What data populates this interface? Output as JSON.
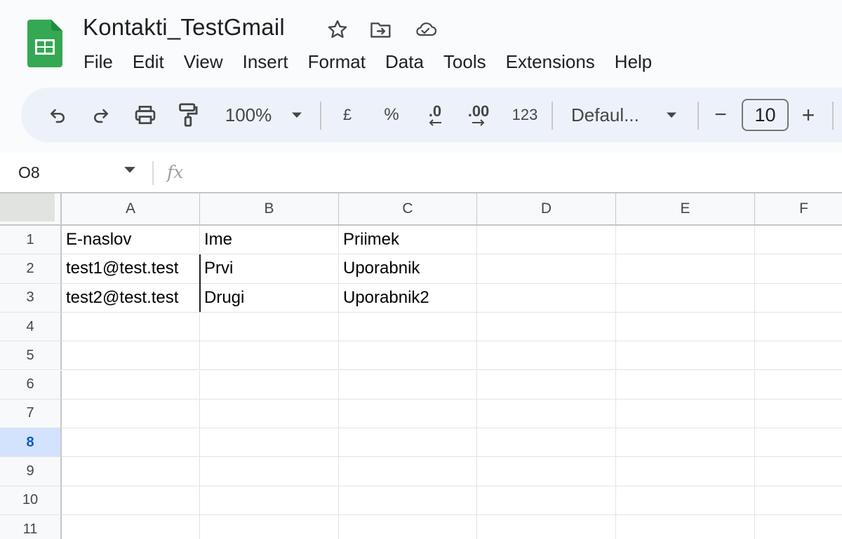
{
  "app": {
    "doc_title": "Kontakti_TestGmail",
    "icons": {
      "logo": "google-sheets-logo",
      "star": "star-icon",
      "move": "move-to-folder-icon",
      "cloud": "cloud-saved-icon"
    },
    "colors": {
      "logo_green": "#34a853",
      "toolbar_bg": "#edf2fa",
      "active_row_bg": "#d3e3fd",
      "active_row_text": "#0b57d0"
    }
  },
  "menu": {
    "items": [
      "File",
      "Edit",
      "View",
      "Insert",
      "Format",
      "Data",
      "Tools",
      "Extensions",
      "Help"
    ]
  },
  "toolbar": {
    "zoom": "100%",
    "currency": "£",
    "percent": "%",
    "decrease_decimal": ".0",
    "increase_decimal": ".00",
    "more_formats": "123",
    "font": "Defaul...",
    "font_size": "10",
    "minus": "−",
    "plus": "+"
  },
  "formula_bar": {
    "name_box": "O8",
    "fx": "fx",
    "value": ""
  },
  "sheet": {
    "columns": [
      "A",
      "B",
      "C",
      "D",
      "E",
      "F"
    ],
    "rows": [
      "1",
      "2",
      "3",
      "4",
      "5",
      "6",
      "7",
      "8",
      "9",
      "10",
      "11"
    ],
    "active_row": "8",
    "cells": [
      [
        "E-naslov",
        "Ime",
        "Priimek",
        "",
        "",
        ""
      ],
      [
        "test1@test.test",
        "Prvi",
        "Uporabnik",
        "",
        "",
        ""
      ],
      [
        "test2@test.test",
        "Drugi",
        "Uporabnik2",
        "",
        "",
        ""
      ]
    ]
  }
}
